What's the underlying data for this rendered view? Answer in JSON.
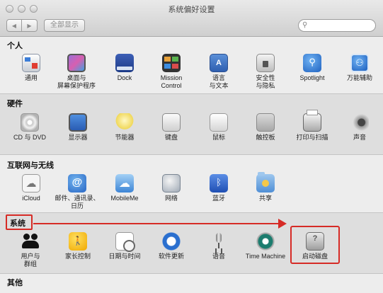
{
  "window": {
    "title": "系统偏好设置",
    "show_all_label": "全部显示",
    "search_placeholder": "",
    "back_icon": "triangle-left",
    "forward_icon": "triangle-right",
    "search_icon": "magnifier"
  },
  "sections": [
    {
      "title": "个人",
      "items": [
        {
          "label": "通用",
          "icon": "general-icon"
        },
        {
          "label": "桌面与\n屏幕保护程序",
          "icon": "desktop-icon"
        },
        {
          "label": "Dock",
          "icon": "dock-icon"
        },
        {
          "label": "Mission\nControl",
          "icon": "mission-control-icon"
        },
        {
          "label": "语言\n与文本",
          "icon": "language-icon"
        },
        {
          "label": "安全性\n与隐私",
          "icon": "security-icon"
        },
        {
          "label": "Spotlight",
          "icon": "spotlight-icon"
        },
        {
          "label": "万能辅助",
          "icon": "accessibility-icon"
        }
      ]
    },
    {
      "title": "硬件",
      "items": [
        {
          "label": "CD 与 DVD",
          "icon": "cd-icon"
        },
        {
          "label": "显示器",
          "icon": "display-icon"
        },
        {
          "label": "节能器",
          "icon": "energy-saver-icon"
        },
        {
          "label": "键盘",
          "icon": "keyboard-icon"
        },
        {
          "label": "鼠标",
          "icon": "mouse-icon"
        },
        {
          "label": "触控板",
          "icon": "trackpad-icon"
        },
        {
          "label": "打印与扫描",
          "icon": "printer-icon"
        },
        {
          "label": "声音",
          "icon": "sound-icon"
        }
      ]
    },
    {
      "title": "互联网与无线",
      "items": [
        {
          "label": "iCloud",
          "icon": "icloud-icon"
        },
        {
          "label": "邮件、通讯录、\n日历",
          "icon": "mail-icon"
        },
        {
          "label": "MobileMe",
          "icon": "mobileme-icon"
        },
        {
          "label": "网络",
          "icon": "network-icon"
        },
        {
          "label": "蓝牙",
          "icon": "bluetooth-icon"
        },
        {
          "label": "共享",
          "icon": "sharing-icon"
        }
      ]
    },
    {
      "title": "系统",
      "items": [
        {
          "label": "用户与\n群组",
          "icon": "users-icon"
        },
        {
          "label": "家长控制",
          "icon": "parental-controls-icon"
        },
        {
          "label": "日期与时间",
          "icon": "date-time-icon"
        },
        {
          "label": "软件更新",
          "icon": "software-update-icon"
        },
        {
          "label": "语音",
          "icon": "speech-icon"
        },
        {
          "label": "Time Machine",
          "icon": "time-machine-icon"
        },
        {
          "label": "启动磁盘",
          "icon": "startup-disk-icon"
        }
      ]
    },
    {
      "title": "其他",
      "items": []
    }
  ],
  "annotation": {
    "color": "#d62b26"
  }
}
